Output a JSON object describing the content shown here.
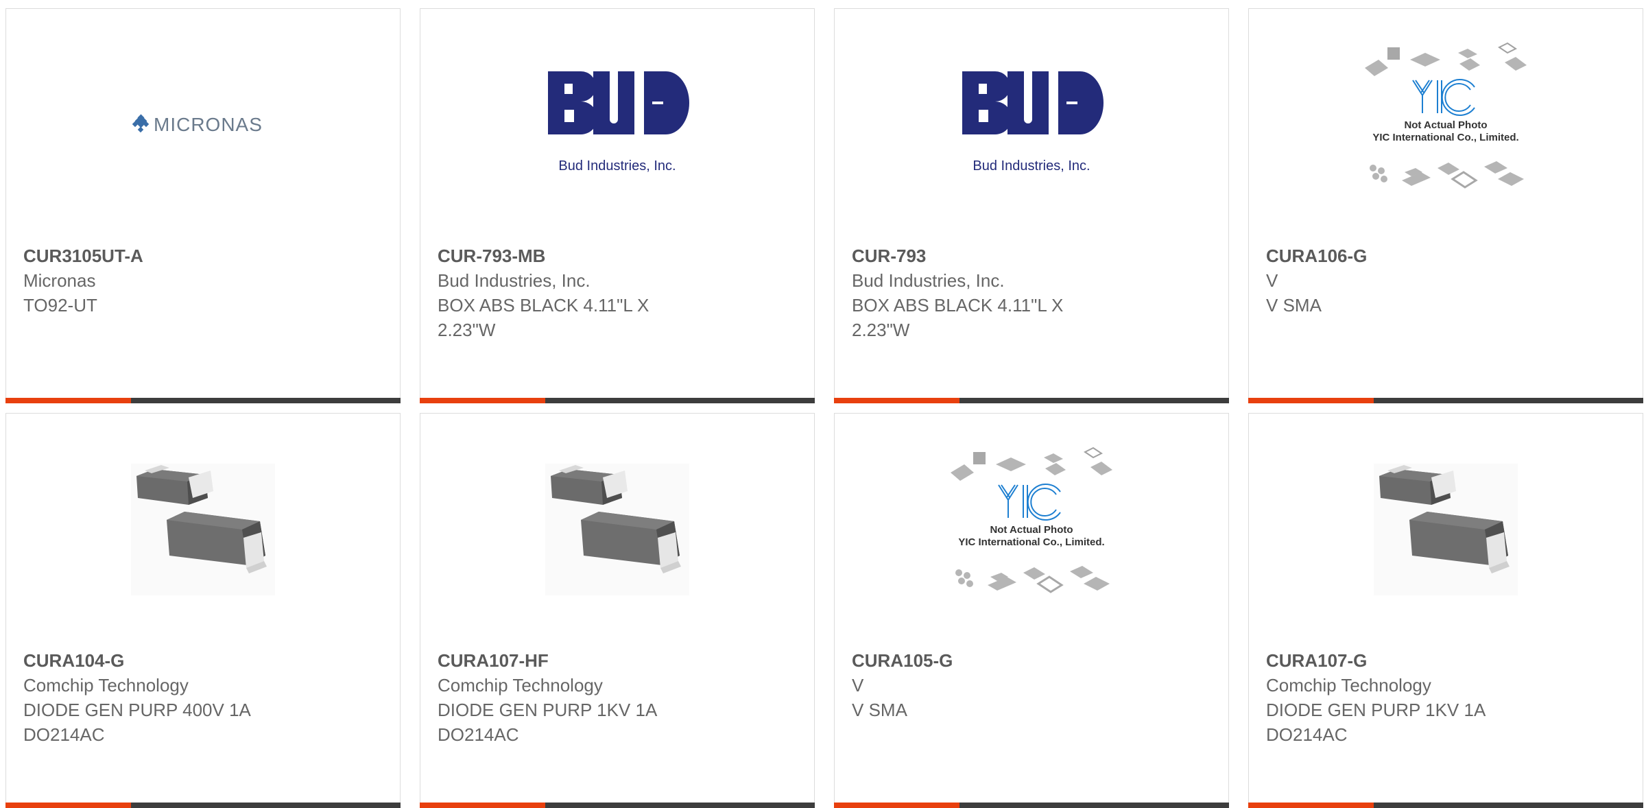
{
  "colors": {
    "accent": "#e8400e",
    "bar_dark": "#3d3d3d",
    "text": "#666666",
    "bud_blue": "#232b7a",
    "yic_blue": "#1d7fd1",
    "micronas_blue": "#3a6ea8"
  },
  "products": [
    {
      "part_number": "CUR3105UT-A",
      "manufacturer": "Micronas",
      "description": "TO92-UT",
      "image": "micronas-logo",
      "logo_text": "MICRONAS"
    },
    {
      "part_number": "CUR-793-MB",
      "manufacturer": "Bud Industries, Inc.",
      "description": "BOX ABS BLACK 4.11\"L X 2.23\"W",
      "image": "bud-logo",
      "logo_text": "Bud Industries, Inc."
    },
    {
      "part_number": "CUR-793",
      "manufacturer": "Bud Industries, Inc.",
      "description": "BOX ABS BLACK 4.11\"L X 2.23\"W",
      "image": "bud-logo",
      "logo_text": "Bud Industries, Inc."
    },
    {
      "part_number": "CURA106-G",
      "manufacturer": "V",
      "description": "V SMA",
      "image": "yic-placeholder",
      "logo_text": "Not Actual Photo",
      "logo_subtext": "YIC International Co., Limited."
    },
    {
      "part_number": "CURA104-G",
      "manufacturer": "Comchip Technology",
      "description": "DIODE GEN PURP 400V 1A DO214AC",
      "image": "diode-photo"
    },
    {
      "part_number": "CURA107-HF",
      "manufacturer": "Comchip Technology",
      "description": "DIODE GEN PURP 1KV 1A DO214AC",
      "image": "diode-photo"
    },
    {
      "part_number": "CURA105-G",
      "manufacturer": "V",
      "description": "V SMA",
      "image": "yic-placeholder",
      "logo_text": "Not Actual Photo",
      "logo_subtext": "YIC International Co., Limited."
    },
    {
      "part_number": "CURA107-G",
      "manufacturer": "Comchip Technology",
      "description": "DIODE GEN PURP 1KV 1A DO214AC",
      "image": "diode-photo"
    }
  ]
}
